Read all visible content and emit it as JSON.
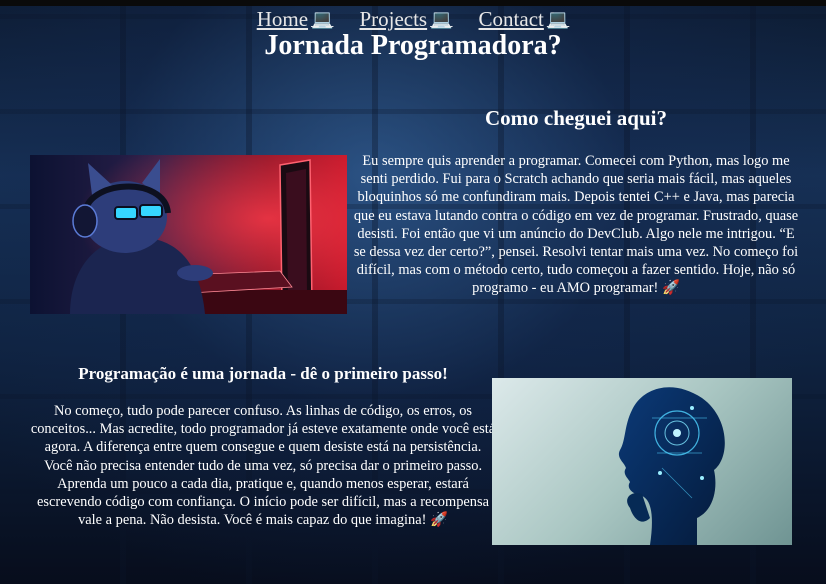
{
  "nav": {
    "items": [
      {
        "label": "Home",
        "icon": "laptop-icon"
      },
      {
        "label": "Projects",
        "icon": "laptop-icon"
      },
      {
        "label": "Contact",
        "icon": "laptop-icon"
      }
    ]
  },
  "header": {
    "title": "Jornada Programadora?"
  },
  "section1": {
    "heading": "Como cheguei aqui?",
    "text": "Eu sempre quis aprender a programar. Comecei com Python, mas logo me senti perdido. Fui para o Scratch achando que seria mais fácil, mas aqueles bloquinhos só me confundiram mais. Depois tentei C++ e Java, mas parecia que eu estava lutando contra o código em vez de programar. Frustrado, quase desisti. Foi então que vi um anúncio do DevClub. Algo nele me intrigou. “E se dessa vez der certo?”, pensei. Resolvi tentar mais uma vez. No começo foi difícil, mas com o método certo, tudo começou a fazer sentido. Hoje, não só programo - eu AMO programar! 🚀",
    "image": "cat-hacker-illustration"
  },
  "section2": {
    "heading": "Programação é uma jornada - dê o primeiro passo!",
    "text": "No começo, tudo pode parecer confuso. As linhas de código, os erros, os conceitos... Mas acredite, todo programador já esteve exatamente onde você está agora. A diferença entre quem consegue e quem desiste está na persistência. Você não precisa entender tudo de uma vez, só precisa dar o primeiro passo. Aprenda um pouco a cada dia, pratique e, quando menos esperar, estará escrevendo código com confiança. O início pode ser difícil, mas a recompensa vale a pena. Não desista. Você é mais capaz do que imagina! 🚀",
    "image": "digital-head-silhouette-illustration"
  },
  "colors": {
    "text": "#ffffff",
    "background": "#0f2341"
  }
}
